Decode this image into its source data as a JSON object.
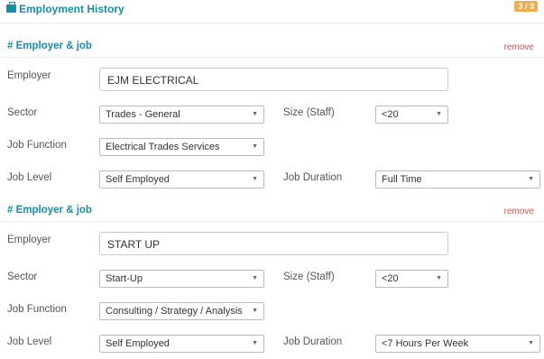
{
  "header": {
    "title": "Employment History",
    "badge": "3 / 3",
    "icon": "briefcase-icon"
  },
  "jobs": [
    {
      "section_title": "# Employer & job",
      "remove_label": "remove",
      "employer_label": "Employer",
      "employer_value": "EJM ELECTRICAL",
      "sector_label": "Sector",
      "sector_value": "Trades - General",
      "size_label": "Size (Staff)",
      "size_value": "<20",
      "function_label": "Job Function",
      "function_value": "Electrical Trades Services",
      "level_label": "Job Level",
      "level_value": "Self Employed",
      "duration_label": "Job Duration",
      "duration_value": "Full Time"
    },
    {
      "section_title": "# Employer & job",
      "remove_label": "remove",
      "employer_label": "Employer",
      "employer_value": "START UP",
      "sector_label": "Sector",
      "sector_value": "Start-Up",
      "size_label": "Size (Staff)",
      "size_value": "<20",
      "function_label": "Job Function",
      "function_value": "Consulting / Strategy / Analysis",
      "level_label": "Job Level",
      "level_value": "Self Employed",
      "duration_label": "Job Duration",
      "duration_value": "<7 Hours Per Week"
    }
  ],
  "colors": {
    "accent": "#1a8ba8",
    "remove": "#d9534f",
    "badge": "#f0ad4e"
  }
}
